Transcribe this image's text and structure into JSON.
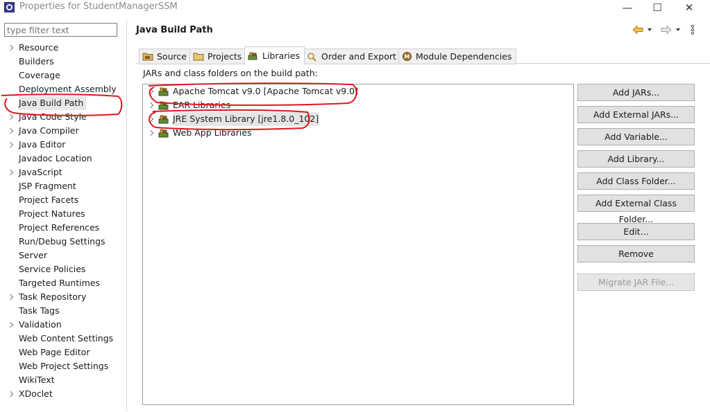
{
  "window": {
    "title": "Properties for StudentManagerSSM",
    "minimize": "—",
    "maximize": "☐",
    "close": "✕"
  },
  "filter": {
    "placeholder": "type filter text"
  },
  "sidebar": {
    "items": [
      {
        "label": "Resource",
        "expandable": true
      },
      {
        "label": "Builders",
        "expandable": false
      },
      {
        "label": "Coverage",
        "expandable": false
      },
      {
        "label": "Deployment Assembly",
        "expandable": false
      },
      {
        "label": "Java Build Path",
        "expandable": false,
        "selected": true
      },
      {
        "label": "Java Code Style",
        "expandable": true
      },
      {
        "label": "Java Compiler",
        "expandable": true
      },
      {
        "label": "Java Editor",
        "expandable": true
      },
      {
        "label": "Javadoc Location",
        "expandable": false
      },
      {
        "label": "JavaScript",
        "expandable": true
      },
      {
        "label": "JSP Fragment",
        "expandable": false
      },
      {
        "label": "Project Facets",
        "expandable": false
      },
      {
        "label": "Project Natures",
        "expandable": false
      },
      {
        "label": "Project References",
        "expandable": false
      },
      {
        "label": "Run/Debug Settings",
        "expandable": false
      },
      {
        "label": "Server",
        "expandable": false
      },
      {
        "label": "Service Policies",
        "expandable": false
      },
      {
        "label": "Targeted Runtimes",
        "expandable": false
      },
      {
        "label": "Task Repository",
        "expandable": true
      },
      {
        "label": "Task Tags",
        "expandable": false
      },
      {
        "label": "Validation",
        "expandable": true
      },
      {
        "label": "Web Content Settings",
        "expandable": false
      },
      {
        "label": "Web Page Editor",
        "expandable": false
      },
      {
        "label": "Web Project Settings",
        "expandable": false
      },
      {
        "label": "WikiText",
        "expandable": false
      },
      {
        "label": "XDoclet",
        "expandable": true
      }
    ]
  },
  "page": {
    "title": "Java Build Path"
  },
  "tabs": [
    {
      "label": "Source"
    },
    {
      "label": "Projects"
    },
    {
      "label": "Libraries",
      "active": true
    },
    {
      "label": "Order and Export"
    },
    {
      "label": "Module Dependencies"
    }
  ],
  "libraries": {
    "label": "JARs and class folders on the build path:",
    "items": [
      {
        "label": "Apache Tomcat v9.0 [Apache Tomcat v9.0]"
      },
      {
        "label": "EAR Libraries"
      },
      {
        "label": "JRE System Library [jre1.8.0_102]",
        "selected": true
      },
      {
        "label": "Web App Libraries"
      }
    ]
  },
  "buttons": {
    "add_jars": "Add JARs...",
    "add_external_jars": "Add External JARs...",
    "add_variable": "Add Variable...",
    "add_library": "Add Library...",
    "add_class_folder": "Add Class Folder...",
    "add_external_class_folder": "Add External Class Folder...",
    "edit": "Edit...",
    "remove": "Remove",
    "migrate_jar": "Migrate JAR File..."
  },
  "colors": {
    "annotation": "#e0141e",
    "nav_arrow": "#e8a317",
    "selected_bg": "#e5e5e5"
  }
}
